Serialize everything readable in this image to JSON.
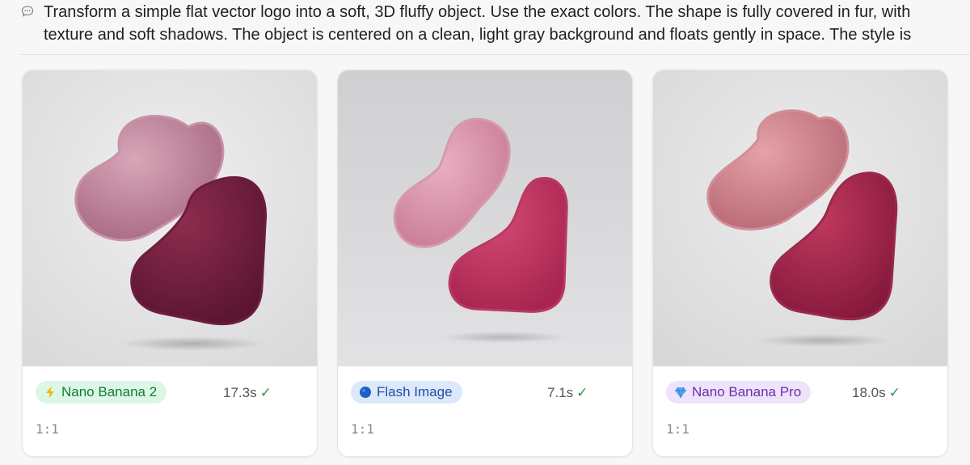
{
  "prompt": {
    "text": "Transform a simple flat vector logo into a soft, 3D fluffy object. Use the exact colors. The shape is fully covered in fur, with\ntexture and soft shadows. The object is centered on a clean, light gray background and floats gently in space. The style is",
    "icon": "chat-bubble-icon"
  },
  "results": [
    {
      "model": "Nano Banana 2",
      "icon": "lightning-icon",
      "time": "17.3s",
      "status": "✓",
      "ratio": "1:1",
      "colors": {
        "bg": "#e6e6e8",
        "light": "#c98aa0",
        "dark": "#7a2040"
      }
    },
    {
      "model": "Flash Image",
      "icon": "blue-circle-icon",
      "time": "7.1s",
      "status": "✓",
      "ratio": "1:1",
      "colors": {
        "bg": "#d4d4d6",
        "light": "#dc8fa8",
        "dark": "#c2325f"
      }
    },
    {
      "model": "Nano Banana Pro",
      "icon": "gem-icon",
      "time": "18.0s",
      "status": "✓",
      "ratio": "1:1",
      "colors": {
        "bg": "#e4e3e4",
        "light": "#d98990",
        "dark": "#a82a4e"
      }
    }
  ]
}
